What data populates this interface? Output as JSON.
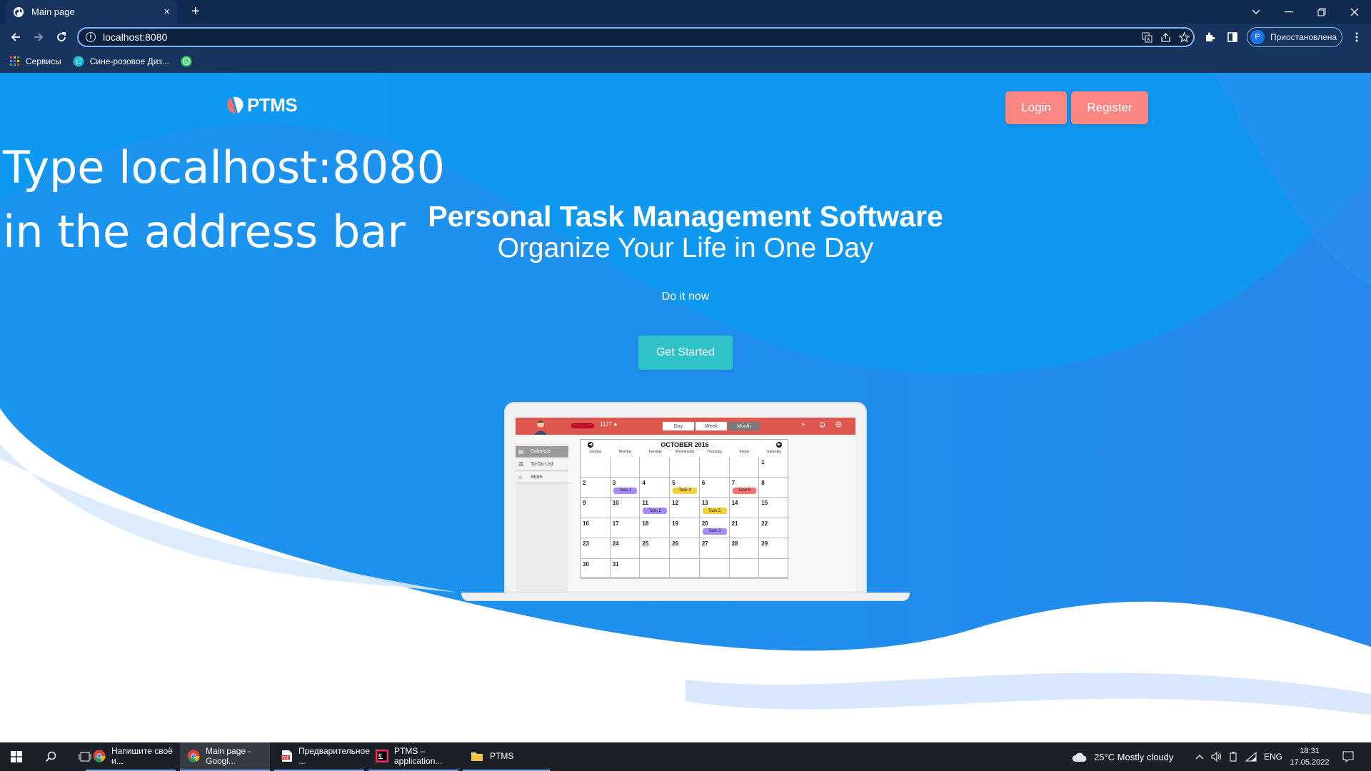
{
  "browser": {
    "tab_title": "Main page",
    "tab_close": "×",
    "new_tab": "+",
    "url": "localhost:8080",
    "profile_initial": "P",
    "profile_status": "Приостановлена",
    "bookmarks": [
      {
        "label": "Сервисы"
      },
      {
        "label": "Сине-розовое Диз..."
      },
      {
        "label": ""
      }
    ]
  },
  "page": {
    "logo_text": "PTMS",
    "login_label": "Login",
    "register_label": "Register",
    "overlay_line1": "Type localhost:8080",
    "overlay_line2": "in the address bar",
    "hero_title": "Personal Task Management Software",
    "hero_subtitle": "Organize Your Life in One Day",
    "tagline": "Do it now",
    "cta_label": "Get Started",
    "colors": {
      "accent": "#fb8782",
      "cta": "#2fc2c9",
      "bg_blue": "#1a9bf0"
    }
  },
  "app_preview": {
    "gold": "1177",
    "view_tabs": [
      "Day",
      "Week",
      "Month"
    ],
    "sidebar": [
      "Calendar",
      "To-Do List",
      "Store"
    ],
    "month_title": "OCTOBER 2016",
    "weekdays": [
      "Sunday",
      "Monday",
      "Tuesday",
      "Wednesday",
      "Thursday",
      "Friday",
      "Saturday"
    ],
    "weeks": [
      [
        "",
        "",
        "",
        "",
        "",
        "",
        "1"
      ],
      [
        "2",
        "3",
        "4",
        "5",
        "6",
        "7",
        "8"
      ],
      [
        "9",
        "10",
        "11",
        "12",
        "13",
        "14",
        "15"
      ],
      [
        "16",
        "17",
        "18",
        "19",
        "20",
        "21",
        "22"
      ],
      [
        "23",
        "24",
        "25",
        "26",
        "27",
        "28",
        "29"
      ],
      [
        "30",
        "31",
        "",
        "",
        "",
        "",
        ""
      ]
    ],
    "tasks": [
      {
        "label": "Task 1",
        "week": 1,
        "day": 1,
        "color": "#a78bfa"
      },
      {
        "label": "Task 4",
        "week": 1,
        "day": 3,
        "color": "#f6d03b"
      },
      {
        "label": "Task 6",
        "week": 1,
        "day": 5,
        "color": "#f87171"
      },
      {
        "label": "Task 2",
        "week": 2,
        "day": 2,
        "color": "#a78bfa"
      },
      {
        "label": "Task 5",
        "week": 2,
        "day": 4,
        "color": "#f6d03b"
      },
      {
        "label": "Task 3",
        "week": 3,
        "day": 4,
        "color": "#a78bfa"
      }
    ]
  },
  "taskbar": {
    "apps": [
      {
        "label": "Напишите своё и...",
        "icon": "chrome-icon"
      },
      {
        "label": "Main page - Googl...",
        "icon": "chrome-icon"
      },
      {
        "label": "Предварительное ...",
        "icon": "pdf-icon"
      },
      {
        "label": "PTMS – application...",
        "icon": "intellij-icon"
      },
      {
        "label": "PTMS",
        "icon": "folder-icon"
      }
    ],
    "weather": "25°C  Mostly cloudy",
    "language": "ENG",
    "time": "18:31",
    "date": "17.05.2022"
  }
}
